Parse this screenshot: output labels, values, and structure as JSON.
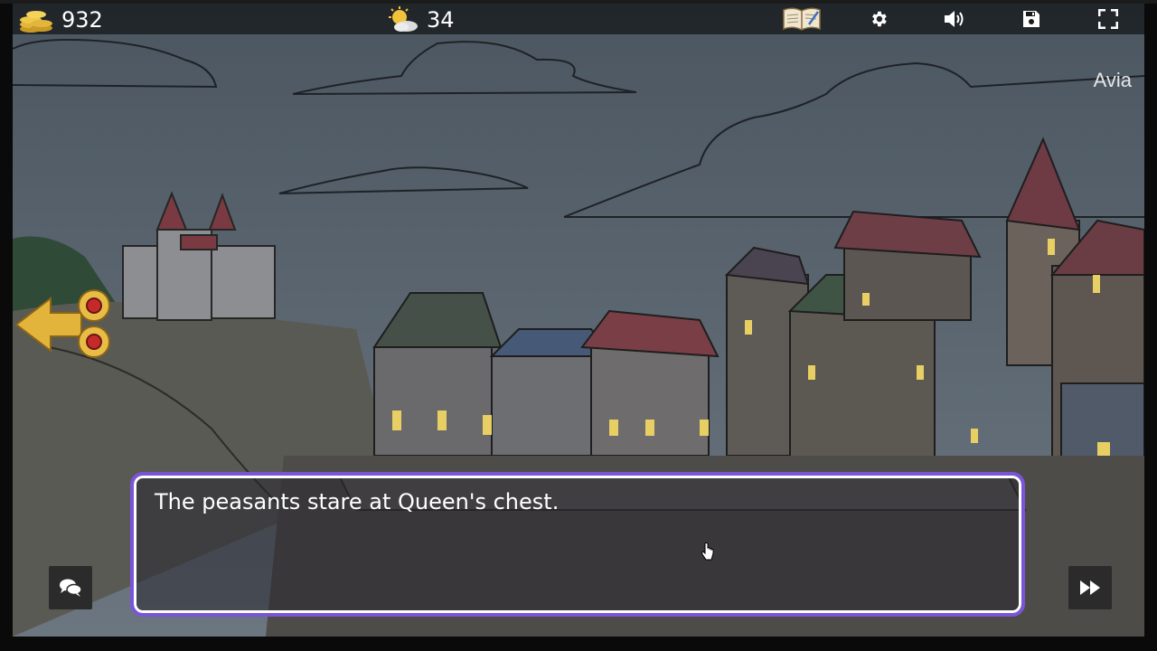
{
  "hud": {
    "gold": "932",
    "energy": "34",
    "icons": {
      "gold": "gold-coins-icon",
      "energy": "sun-cloud-icon",
      "journal": "journal-book-icon",
      "settings": "gear-icon",
      "sound": "speaker-icon",
      "save": "floppy-disk-icon",
      "fullscreen": "fullscreen-icon"
    }
  },
  "scene": {
    "character_name": "Avia"
  },
  "dialog": {
    "text": "The peasants stare at Queen's chest."
  },
  "controls": {
    "back_arrow_icon": "golden-arrow-left-icon",
    "chat_icon": "chat-bubbles-icon",
    "skip_icon": "fast-forward-icon"
  },
  "colors": {
    "dialog_border": "#7a55d8",
    "gold": "#e3b53a",
    "hud_bar": "#000000"
  }
}
